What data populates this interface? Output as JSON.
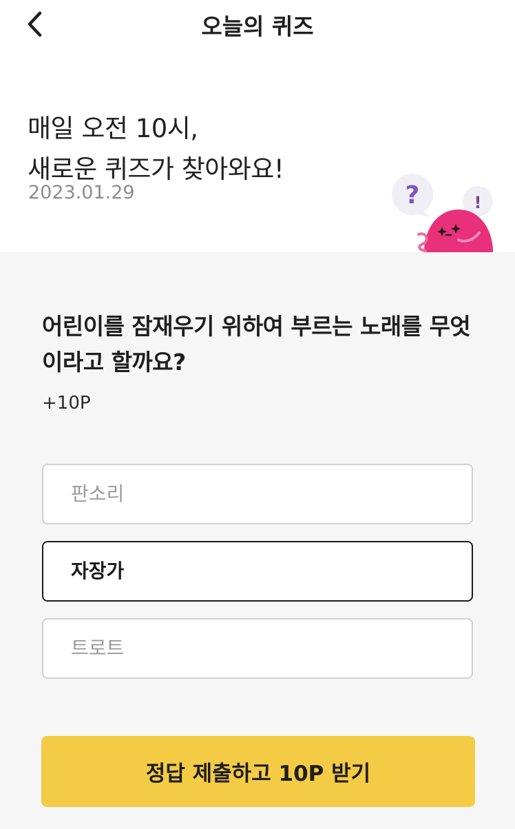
{
  "header": {
    "title": "오늘의 퀴즈",
    "back_icon": "chevron-left-icon"
  },
  "intro": {
    "line1": "매일 오전 10시,",
    "line2": "새로운 퀴즈가 찾아와요!",
    "date": "2023.01.29",
    "mascot": {
      "question_mark": "?",
      "exclamation_mark": "!",
      "colors": {
        "body": "#e8317a",
        "bubble": "#efeff5",
        "question": "#7e57c2",
        "exclamation": "#7a4a92"
      }
    }
  },
  "quiz": {
    "question": "어린이를 잠재우기 위하여 부르는 노래를 무엇이라고 할까요?",
    "points": "+10P",
    "options": [
      {
        "label": "판소리",
        "selected": false
      },
      {
        "label": "자장가",
        "selected": true
      },
      {
        "label": "트로트",
        "selected": false
      }
    ],
    "submit_label": "정답 제출하고 10P 받기"
  },
  "colors": {
    "accent": "#f4cb45",
    "quiz_background": "#f6f6f6",
    "selected_border": "#1a1a1a",
    "option_border": "#d0d0d0"
  }
}
